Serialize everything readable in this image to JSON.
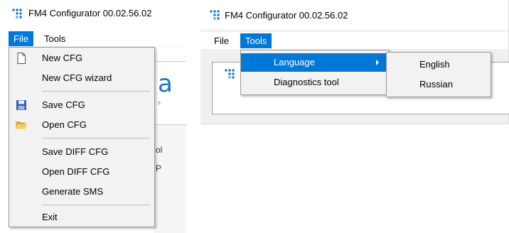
{
  "left_window": {
    "title": "FM4 Configurator 00.02.56.02",
    "menu": {
      "file": "File",
      "tools": "Tools"
    },
    "file_menu": {
      "items": [
        {
          "label": "New CFG",
          "icon": "new-document-icon"
        },
        {
          "label": "New CFG wizard",
          "icon": ""
        },
        {
          "label": "Save CFG",
          "icon": "floppy-disk-icon"
        },
        {
          "label": "Open CFG",
          "icon": "open-folder-icon"
        },
        {
          "label": "Save DIFF CFG",
          "icon": ""
        },
        {
          "label": "Open DIFF CFG",
          "icon": ""
        },
        {
          "label": "Generate SMS",
          "icon": ""
        },
        {
          "label": "Exit",
          "icon": ""
        }
      ]
    },
    "background_fragments": {
      "logo_char": "a",
      "small_text": "s",
      "frag1": "ol",
      "frag2": "P"
    }
  },
  "right_window": {
    "title": "FM4 Configurator 00.02.56.02",
    "menu": {
      "file": "File",
      "tools": "Tools"
    },
    "tools_menu": {
      "items": [
        {
          "label": "Language",
          "has_submenu": true
        },
        {
          "label": "Diagnostics tool",
          "has_submenu": false
        }
      ]
    },
    "language_submenu": {
      "items": [
        {
          "label": "English"
        },
        {
          "label": "Russian"
        }
      ]
    }
  },
  "colors": {
    "highlight": "#0078d7",
    "menu_bg": "#f2f2f2",
    "window_bg": "#f0f0f0",
    "logo_blue": "#1a73c9"
  }
}
